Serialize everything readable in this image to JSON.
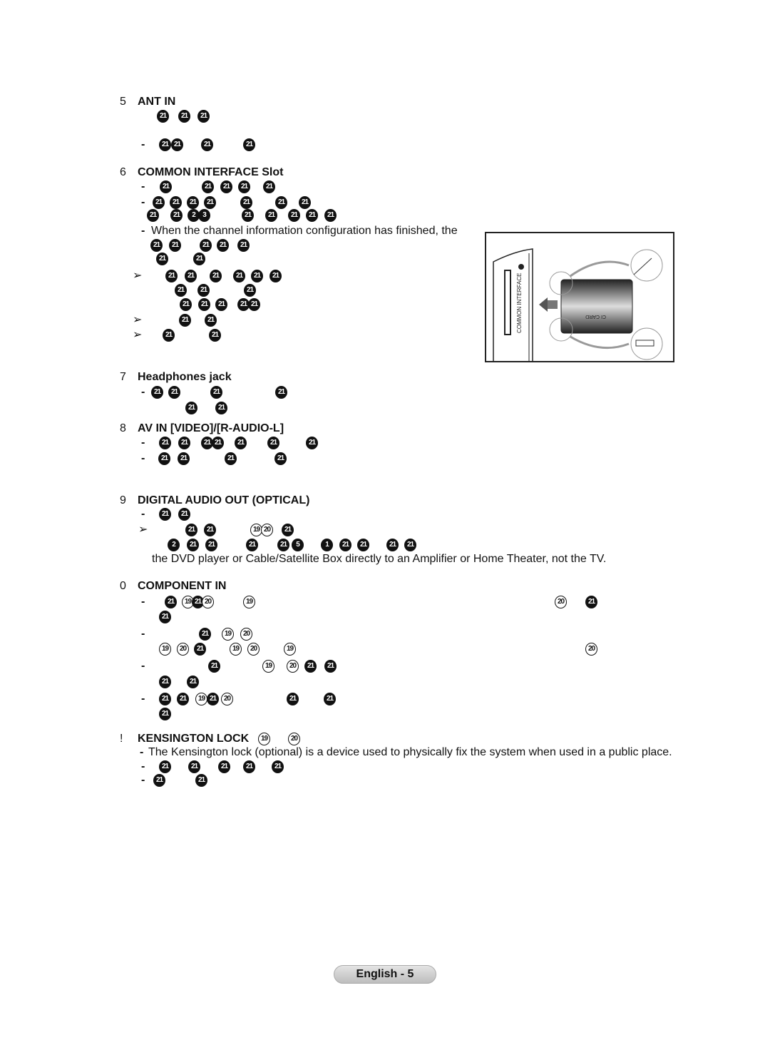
{
  "lines": [
    {
      "type": "heading",
      "num": "5",
      "title": "ANT IN",
      "glyphs": []
    },
    {
      "type": "body",
      "marker": "",
      "text": "",
      "glyphs": [
        "21",
        "21",
        "21"
      ]
    },
    {
      "type": "body",
      "marker": "-",
      "text": "",
      "glyphs": [
        "21",
        "21",
        "21",
        "21"
      ]
    },
    {
      "type": "heading",
      "num": "6",
      "title": "COMMON INTERFACE Slot",
      "glyphs": []
    },
    {
      "type": "body",
      "marker": "-",
      "text": "",
      "glyphs": [
        "21",
        "21",
        "21",
        "21",
        "21"
      ]
    },
    {
      "type": "body",
      "marker": "-",
      "text": "",
      "glyphs": [
        "21",
        "21",
        "21",
        "21",
        "21",
        "21",
        "21"
      ]
    },
    {
      "type": "body",
      "marker": "",
      "text": "",
      "glyphs": [
        "21",
        "21",
        "2",
        "3",
        "21",
        "21",
        "21",
        "21",
        "21"
      ]
    },
    {
      "type": "body",
      "marker": "-",
      "text": "When the channel information configuration has finished, the",
      "glyphs": []
    },
    {
      "type": "body",
      "marker": "",
      "text": "",
      "glyphs": [
        "21",
        "21",
        "21",
        "21",
        "21"
      ]
    },
    {
      "type": "body",
      "marker": "",
      "text": "",
      "glyphs": [
        "21",
        "21"
      ]
    },
    {
      "type": "body",
      "marker": "➢",
      "text": "",
      "glyphs": [
        "21",
        "21",
        "21",
        "21",
        "21",
        "21"
      ]
    },
    {
      "type": "body",
      "marker": "",
      "text": "",
      "glyphs": [
        "21",
        "21",
        "21"
      ]
    },
    {
      "type": "body",
      "marker": "",
      "text": "",
      "glyphs": [
        "21",
        "21",
        "21",
        "21",
        "21"
      ]
    },
    {
      "type": "body",
      "marker": "➢",
      "text": "",
      "glyphs": [
        "21",
        "21"
      ]
    },
    {
      "type": "body",
      "marker": "➢",
      "text": "",
      "glyphs": [
        "21",
        "21"
      ]
    },
    {
      "type": "heading",
      "num": "7",
      "title": "Headphones jack",
      "glyphs": []
    },
    {
      "type": "body",
      "marker": "-",
      "text": "",
      "glyphs": [
        "21",
        "21",
        "21",
        "21"
      ]
    },
    {
      "type": "body",
      "marker": "",
      "text": "",
      "glyphs": [
        "21",
        "21"
      ]
    },
    {
      "type": "heading",
      "num": "8",
      "title": "AV IN [VIDEO]/[R-AUDIO-L]",
      "glyphs": []
    },
    {
      "type": "body",
      "marker": "-",
      "text": "",
      "glyphs": [
        "21",
        "21",
        "21",
        "21",
        "21",
        "21",
        "21"
      ]
    },
    {
      "type": "body",
      "marker": "-",
      "text": "",
      "glyphs": [
        "21",
        "21",
        "21",
        "21"
      ]
    },
    {
      "type": "heading",
      "num": "9",
      "title": "DIGITAL AUDIO OUT (OPTICAL)",
      "glyphs": []
    },
    {
      "type": "body",
      "marker": "-",
      "text": "",
      "glyphs": [
        "21",
        "21"
      ]
    },
    {
      "type": "body",
      "marker": "➢",
      "text": "",
      "glyphs": [
        "21",
        "21",
        "19",
        "20",
        "21"
      ]
    },
    {
      "type": "body",
      "marker": "",
      "text": "",
      "glyphs": [
        "2",
        "21",
        "21",
        "21",
        "21",
        "5",
        "1",
        "21",
        "21",
        "21",
        "21"
      ]
    },
    {
      "type": "body",
      "marker": "",
      "text": "the DVD player or Cable/Satellite Box directly to an Amplifier or Home Theater, not the TV.",
      "glyphs": []
    },
    {
      "type": "heading",
      "num": "0",
      "title": "COMPONENT IN",
      "glyphs": []
    },
    {
      "type": "body",
      "marker": "-",
      "text": "",
      "glyphs": [
        "21",
        "19",
        "21",
        "20",
        "19",
        "20",
        "21"
      ]
    },
    {
      "type": "body",
      "marker": "",
      "text": "",
      "glyphs": [
        "21"
      ]
    },
    {
      "type": "body",
      "marker": "-",
      "text": "",
      "glyphs": [
        "21",
        "19",
        "20"
      ]
    },
    {
      "type": "body",
      "marker": "",
      "text": "",
      "glyphs": [
        "19",
        "20",
        "21",
        "19",
        "20",
        "19",
        "20"
      ]
    },
    {
      "type": "body",
      "marker": "-",
      "text": "",
      "glyphs": [
        "21",
        "19",
        "20",
        "21",
        "21"
      ]
    },
    {
      "type": "body",
      "marker": "",
      "text": "",
      "glyphs": [
        "21",
        "21"
      ]
    },
    {
      "type": "body",
      "marker": "-",
      "text": "",
      "glyphs": [
        "21",
        "21",
        "19",
        "21",
        "20",
        "21",
        "21"
      ]
    },
    {
      "type": "body",
      "marker": "",
      "text": "",
      "glyphs": [
        "21"
      ]
    },
    {
      "type": "heading",
      "num": "!",
      "title": "KENSINGTON LOCK",
      "glyphs": [
        "19",
        "20"
      ]
    },
    {
      "type": "body",
      "marker": "-",
      "text": "The Kensington lock (optional) is a device used to physically fix the system when used in a public place.",
      "glyphs": []
    },
    {
      "type": "body",
      "marker": "-",
      "text": "",
      "glyphs": [
        "21",
        "21",
        "21",
        "21",
        "21"
      ]
    },
    {
      "type": "body",
      "marker": "-",
      "text": "",
      "glyphs": [
        "21",
        "21"
      ]
    }
  ],
  "figure": {
    "slot_label": "COMMON INTERFACE",
    "card_label": "CI CARD"
  },
  "footer": {
    "page_label": "English - 5"
  }
}
